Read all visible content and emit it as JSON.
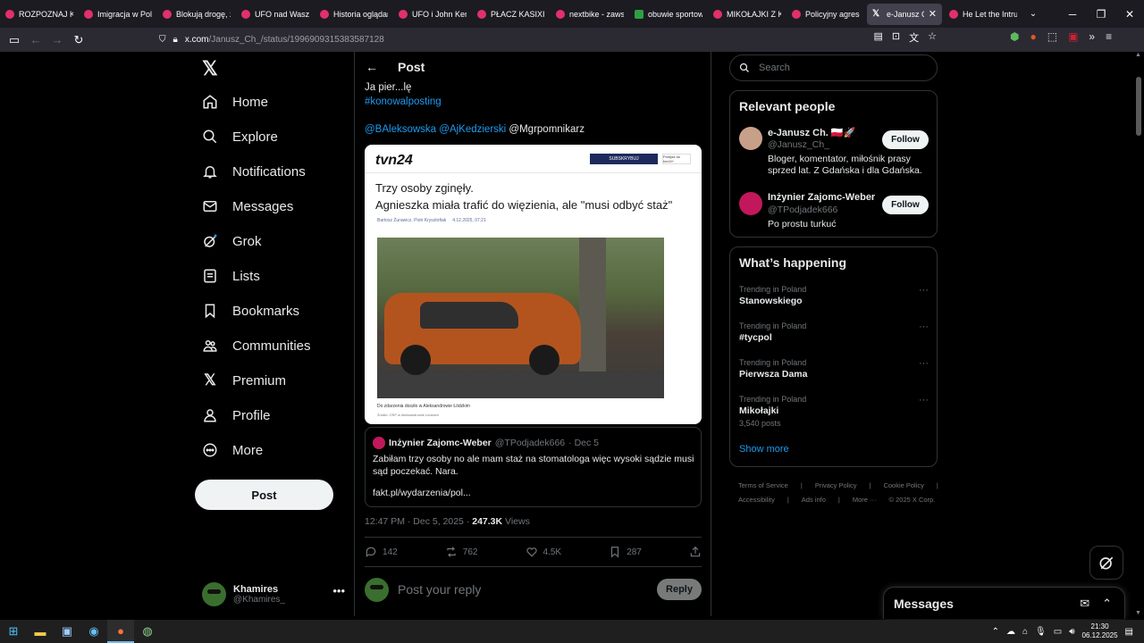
{
  "browser": {
    "tabs": [
      {
        "label": "ROZPOZNAJ KO",
        "favicon": "youtube"
      },
      {
        "label": "Imigracja w Pols",
        "favicon": "youtube"
      },
      {
        "label": "Blokują drogę, z",
        "favicon": "youtube"
      },
      {
        "label": "UFO nad Waszyn",
        "favicon": "youtube"
      },
      {
        "label": "Historia oglądan",
        "favicon": "youtube"
      },
      {
        "label": "UFO i John Kenn",
        "favicon": "youtube"
      },
      {
        "label": "PŁACZ KASIXI LE",
        "favicon": "youtube"
      },
      {
        "label": "nextbike - zawsz",
        "favicon": "youtube"
      },
      {
        "label": "obuwie sportow",
        "favicon": "shop"
      },
      {
        "label": "MIKOŁAJKI Z KA",
        "favicon": "youtube"
      },
      {
        "label": "Policyjny agreso",
        "favicon": "youtube"
      },
      {
        "label": "e-Janusz Ch.",
        "favicon": "x",
        "active": true
      },
      {
        "label": "He Let the Intru",
        "favicon": "youtube"
      }
    ],
    "url_host": "x.com",
    "url_path": "/Janusz_Ch_/status/1996909315383587128"
  },
  "leftnav": {
    "items": [
      {
        "label": "Home",
        "icon": "home-icon"
      },
      {
        "label": "Explore",
        "icon": "search-icon"
      },
      {
        "label": "Notifications",
        "icon": "bell-icon"
      },
      {
        "label": "Messages",
        "icon": "envelope-icon"
      },
      {
        "label": "Grok",
        "icon": "grok-icon"
      },
      {
        "label": "Lists",
        "icon": "list-icon"
      },
      {
        "label": "Bookmarks",
        "icon": "bookmark-icon"
      },
      {
        "label": "Communities",
        "icon": "people-icon"
      },
      {
        "label": "Premium",
        "icon": "x-icon"
      },
      {
        "label": "Profile",
        "icon": "person-icon"
      },
      {
        "label": "More",
        "icon": "more-circle-icon"
      }
    ],
    "post_button": "Post",
    "account": {
      "name": "Khamires",
      "handle": "@Khamires_"
    }
  },
  "main": {
    "header_title": "Post",
    "text_line1": "Ja pier...lę",
    "hashtag": "#konowalposting",
    "mention1": "@BAleksowska",
    "mention2": "@AjKedzierski",
    "mention3": "@Mgrpomnikarz",
    "article": {
      "logo": "tvn24",
      "subscribe": "SUBSKRYBUJ",
      "go_to": "Przejdź do tvn24+",
      "headline1": "Trzy osoby zginęły.",
      "headline2": "Agnieszka miała trafić do więzienia, ale \"musi odbyć staż\"",
      "authors": "Bartosz Żurawicz, Piotr Krysztofiak",
      "date": "4.12.2025, 07:21",
      "caption": "Do zdarzenia doszło w Aleksandrowie Łódzkim",
      "source": "Źródło: OSP w Aleksandrowie Łódzkim"
    },
    "quote": {
      "name": "Inżynier Zajomc-Weber",
      "handle": "@TPodjadek666",
      "date": "· Dec 5",
      "text": "Zabiłam trzy osoby no ale mam staż na stomatologa więc wysoki sądzie musi sąd poczekać. Nara.",
      "link": "fakt.pl/wydarzenia/pol..."
    },
    "meta_time": "12:47 PM · Dec 5, 2025 · ",
    "meta_views_count": "247.3K",
    "meta_views_label": " Views",
    "actions": {
      "replies": "142",
      "reposts": "762",
      "likes": "4.5K",
      "bookmarks": "287"
    },
    "reply_placeholder": "Post your reply",
    "reply_button": "Reply"
  },
  "right": {
    "search_placeholder": "Search",
    "relevant_title": "Relevant people",
    "people": [
      {
        "name": "e-Janusz Ch. 🇵🇱🚀",
        "handle": "@Janusz_Ch_",
        "bio": "Bloger, komentator, miłośnik prasy sprzed lat. Z Gdańska i dla Gdańska.",
        "button": "Follow"
      },
      {
        "name": "Inżynier Zajomc-Weber",
        "handle": "@TPodjadek666",
        "bio": "Po prostu turkuć",
        "button": "Follow"
      }
    ],
    "happening_title": "What’s happening",
    "trends": [
      {
        "meta": "Trending in Poland",
        "name": "Stanowskiego",
        "count": ""
      },
      {
        "meta": "Trending in Poland",
        "name": "#tycpol",
        "count": ""
      },
      {
        "meta": "Trending in Poland",
        "name": "Pierwsza Dama",
        "count": ""
      },
      {
        "meta": "Trending in Poland",
        "name": "Mikołajki",
        "count": "3,540 posts"
      }
    ],
    "show_more": "Show more",
    "footer": [
      "Terms of Service",
      "|",
      "Privacy Policy",
      "|",
      "Cookie Policy",
      "|",
      "Accessibility",
      "|",
      "Ads info",
      "|",
      "More ···",
      "© 2025 X Corp."
    ]
  },
  "messages_drawer": {
    "title": "Messages"
  },
  "taskbar": {
    "time": "21:30",
    "date": "06.12.2025"
  },
  "colors": {
    "accent": "#1d9bf0",
    "background": "#000000",
    "border": "#2f3336",
    "muted": "#71767b"
  }
}
